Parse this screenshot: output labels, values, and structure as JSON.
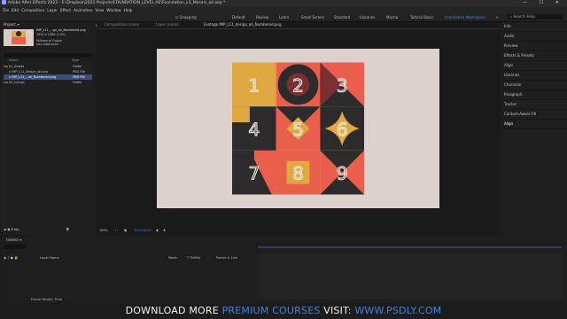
{
  "window": {
    "title": "Adobe After Effects 2023 - E:\\Dropbox\\2023 Projects\\FOUNDATION_LEVEL AE\\Foundation_L3_Mosaic_all.aep *",
    "controls": "— ☐ ✕"
  },
  "menu": [
    "File",
    "Edit",
    "Composition",
    "Layer",
    "Effect",
    "Animation",
    "View",
    "Window",
    "Help"
  ],
  "toolbar": {
    "snapping_label": "Snapping",
    "workspaces": [
      "Default",
      "Review",
      "Learn",
      "Small Screen",
      "Standard",
      "Libraries",
      "Mocha",
      "Tutorial Basic",
      "Foundation Workspace"
    ],
    "active_workspace": "Foundation Workspace",
    "search_placeholder": "Search Help"
  },
  "project": {
    "title": "Project ≡",
    "file_name": "IMP_L11_...gn_all_Numbered.png",
    "dims": "1920 x 1080 (1.00)",
    "colors": "Millions of Colors",
    "interlace": "non-Interlaced",
    "col_name": "Name",
    "col_type": "Type",
    "items": [
      {
        "name": "01_Assets",
        "type": "Folder",
        "indent": 0
      },
      {
        "name": "IMP_L11_Design_all.png",
        "type": "PNG File",
        "indent": 1
      },
      {
        "name": "IMP_L11_...all_Numbered.png",
        "type": "PNG File",
        "indent": 1,
        "selected": true
      },
      {
        "name": "02_Comps",
        "type": "Folder",
        "indent": 0
      }
    ],
    "bpc": "8 bpc"
  },
  "viewer": {
    "tabs": [
      "Composition (none)",
      "Layer (none)",
      "Footage IMP_L11_design_all_Numbered.png"
    ],
    "zoom": "100%",
    "bottom_items": [
      "100%",
      "⛶",
      "▣",
      "0;00;00;00",
      "◉",
      "♣"
    ]
  },
  "right_panel": {
    "items": [
      "Info",
      "Audio",
      "Preview",
      "Effects & Presets",
      "Align",
      "Libraries",
      "Character",
      "Paragraph",
      "Tracker",
      "Content-Aware Fill",
      "Align"
    ]
  },
  "timeline": {
    "tab": "(none) ≡",
    "col_layer": "Layer Name",
    "col_mode": "Mode",
    "col_trkmat": "T TrkMat",
    "col_parent": "Parent & Link",
    "render_label": "Frame Render Time"
  },
  "mosaic": {
    "numbers": [
      "1",
      "2",
      "3",
      "4",
      "5",
      "6",
      "7",
      "8",
      "9"
    ]
  },
  "banner": {
    "prefix": "DOWNLOAD MORE ",
    "accent1": "PREMIUM COURSES",
    "middle": " VISIT: ",
    "accent2": "WWW.PSDLY.COM"
  },
  "colors": {
    "accent": "#3a8ee6",
    "mustard": "#e0a840",
    "coral": "#ea5f4c",
    "dark": "#2e2b2c",
    "maroon": "#7a2f33",
    "canvas": "#dcd1cc"
  }
}
